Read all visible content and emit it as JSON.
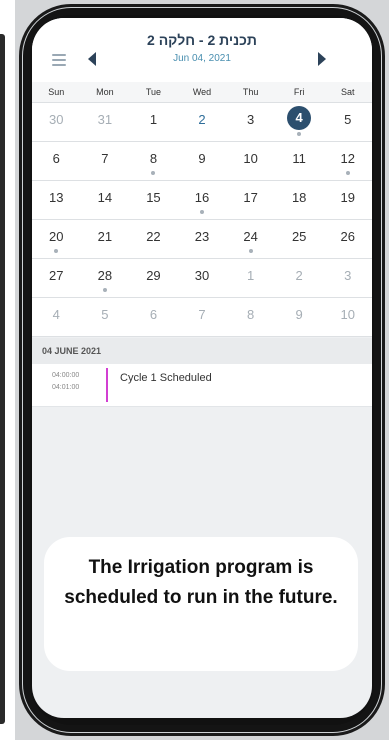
{
  "header": {
    "title": "תכנית 2 - חלקה 2",
    "subtitle": "Jun 04, 2021"
  },
  "weekdays": [
    "Sun",
    "Mon",
    "Tue",
    "Wed",
    "Thu",
    "Fri",
    "Sat"
  ],
  "weeks": [
    [
      {
        "d": "30",
        "other": true
      },
      {
        "d": "31",
        "other": true
      },
      {
        "d": "1"
      },
      {
        "d": "2",
        "blue": true
      },
      {
        "d": "3"
      },
      {
        "d": "4",
        "selected": true,
        "dot": true
      },
      {
        "d": "5"
      }
    ],
    [
      {
        "d": "6"
      },
      {
        "d": "7"
      },
      {
        "d": "8",
        "dot": true
      },
      {
        "d": "9"
      },
      {
        "d": "10"
      },
      {
        "d": "11"
      },
      {
        "d": "12",
        "dot": true
      }
    ],
    [
      {
        "d": "13"
      },
      {
        "d": "14"
      },
      {
        "d": "15"
      },
      {
        "d": "16",
        "dot": true
      },
      {
        "d": "17"
      },
      {
        "d": "18"
      },
      {
        "d": "19"
      }
    ],
    [
      {
        "d": "20",
        "dot": true
      },
      {
        "d": "21"
      },
      {
        "d": "22"
      },
      {
        "d": "23"
      },
      {
        "d": "24",
        "dot": true
      },
      {
        "d": "25"
      },
      {
        "d": "26"
      }
    ],
    [
      {
        "d": "27"
      },
      {
        "d": "28",
        "dot": true
      },
      {
        "d": "29"
      },
      {
        "d": "30"
      },
      {
        "d": "1",
        "other": true
      },
      {
        "d": "2",
        "other": true
      },
      {
        "d": "3",
        "other": true
      }
    ],
    [
      {
        "d": "4",
        "other": true
      },
      {
        "d": "5",
        "other": true
      },
      {
        "d": "6",
        "other": true
      },
      {
        "d": "7",
        "other": true
      },
      {
        "d": "8",
        "other": true
      },
      {
        "d": "9",
        "other": true
      },
      {
        "d": "10",
        "other": true
      }
    ]
  ],
  "agenda": {
    "date_label": "04 JUNE 2021",
    "events": [
      {
        "start": "04:00:00",
        "end": "04:01:00",
        "name": "Cycle 1 Scheduled",
        "color": "#d23fd2"
      }
    ]
  },
  "caption": "The Irrigation program is scheduled to run in the future.",
  "icons": {
    "menu": "hamburger-menu-icon",
    "prev": "triangle-left-icon",
    "next": "triangle-right-icon"
  },
  "colors": {
    "accent": "#2c4259",
    "selected_day": "#2c4f6e",
    "event_bar": "#d23fd2"
  }
}
